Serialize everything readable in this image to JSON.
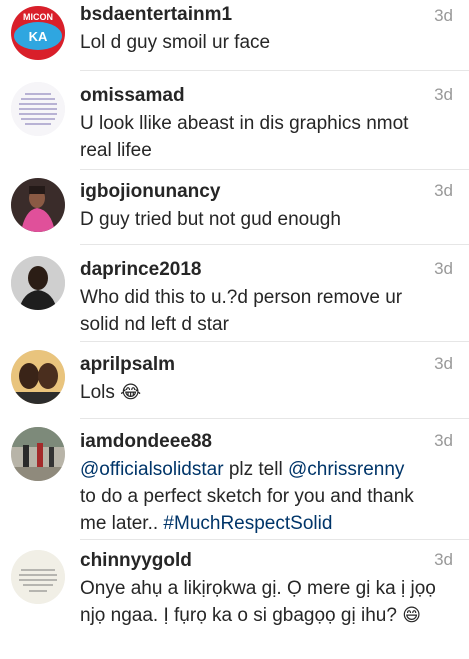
{
  "comments": [
    {
      "username": "bsdaentertainm1",
      "text": "Lol d guy smoil ur face",
      "time": "3d",
      "avatar": "MICON KA logo",
      "avatar_colors": {
        "bg": "#d91f2a",
        "accent": "#2fa6e0"
      },
      "avatar_label_top": "MICON",
      "avatar_label_mid": "KA"
    },
    {
      "username": "omissamad",
      "text": "U look llike abeast in dis graphics nmot real lifee",
      "time": "3d",
      "avatar": "text quote image"
    },
    {
      "username": "igbojionunancy",
      "text": "D guy tried but not gud enough",
      "time": "3d",
      "avatar": "person in pink photo"
    },
    {
      "username": "daprince2018",
      "text": "Who did this to u.?d person remove ur solid nd left d star",
      "time": "3d",
      "avatar": "person portrait photo"
    },
    {
      "username": "aprilpsalm",
      "text": "Lols",
      "emoji": "😂",
      "time": "3d",
      "avatar": "two people selfie"
    },
    {
      "username": "iamdondeee88",
      "text_parts": [
        {
          "type": "mention",
          "value": "@officialsolidstar"
        },
        {
          "type": "text",
          "value": " plz tell "
        },
        {
          "type": "mention",
          "value": "@chrissrenny"
        },
        {
          "type": "text",
          "value": " to do a perfect sketch for you and thank me later.. "
        },
        {
          "type": "hashtag",
          "value": "#MuchRespectSolid"
        }
      ],
      "time": "3d",
      "avatar": "people in street photo"
    },
    {
      "username": "chinnyygold",
      "text": "Onye ahụ a likịrọkwa gị. Ọ mere gị ka ị jọọ njọ ngaa. Ị fụrọ ka o si gbagọọ gị ihu?",
      "emoji": "😄",
      "time": "3d",
      "avatar": "text quote image"
    }
  ]
}
